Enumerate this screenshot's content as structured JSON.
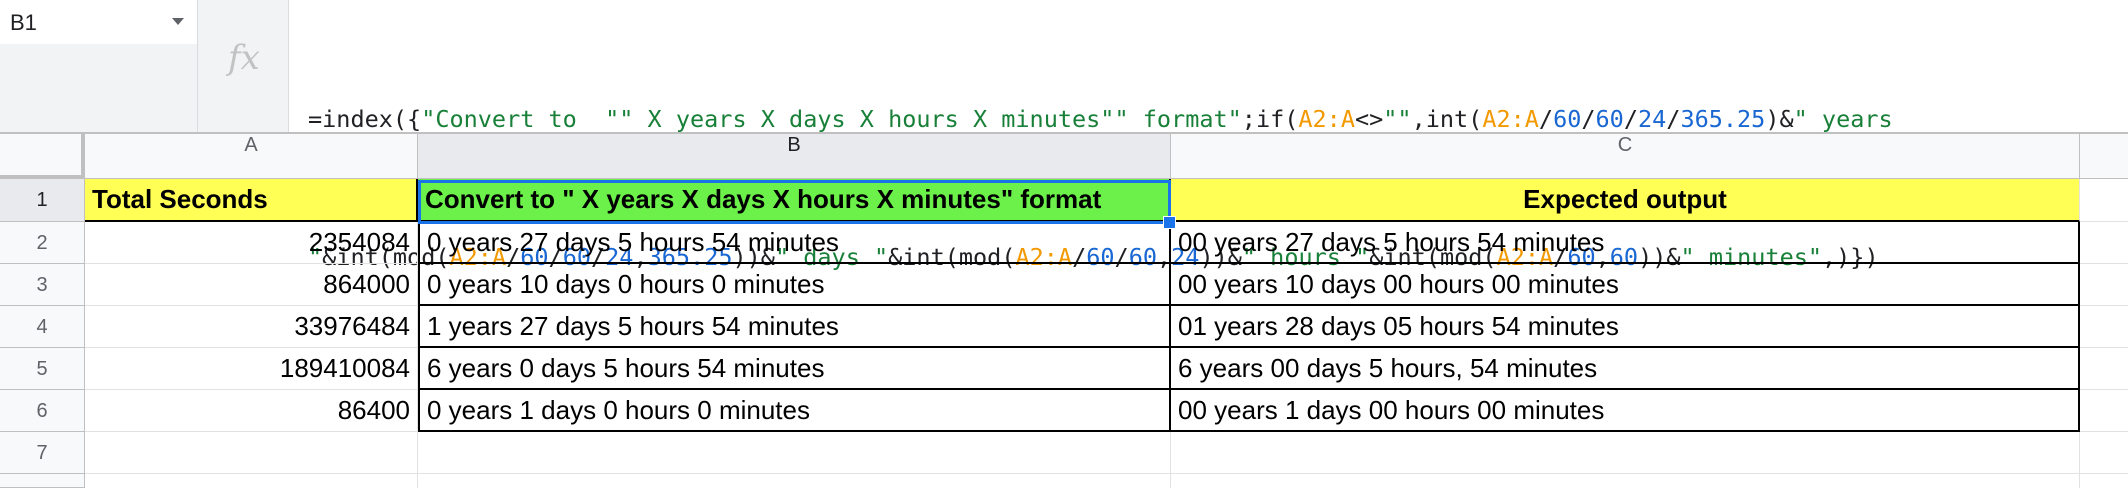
{
  "name_box": {
    "ref": "B1"
  },
  "fx_label": "fx",
  "formula": {
    "line1": [
      {
        "t": "=index({",
        "c": "#202124"
      },
      {
        "t": "\"Convert to  \"\" X years X days X hours X minutes\"\" format\"",
        "c": "#188038"
      },
      {
        "t": ";if(",
        "c": "#202124"
      },
      {
        "t": "A2:A",
        "c": "#f29900"
      },
      {
        "t": "<>",
        "c": "#202124"
      },
      {
        "t": "\"\"",
        "c": "#188038"
      },
      {
        "t": ",int(",
        "c": "#202124"
      },
      {
        "t": "A2:A",
        "c": "#f29900"
      },
      {
        "t": "/",
        "c": "#202124"
      },
      {
        "t": "60",
        "c": "#1967d2"
      },
      {
        "t": "/",
        "c": "#202124"
      },
      {
        "t": "60",
        "c": "#1967d2"
      },
      {
        "t": "/",
        "c": "#202124"
      },
      {
        "t": "24",
        "c": "#1967d2"
      },
      {
        "t": "/",
        "c": "#202124"
      },
      {
        "t": "365.25",
        "c": "#1967d2"
      },
      {
        "t": ")&",
        "c": "#202124"
      },
      {
        "t": "\" years",
        "c": "#188038"
      }
    ],
    "line2": [
      {
        "t": "\"",
        "c": "#188038"
      },
      {
        "t": "&int(mod(",
        "c": "#202124"
      },
      {
        "t": "A2:A",
        "c": "#f29900"
      },
      {
        "t": "/",
        "c": "#202124"
      },
      {
        "t": "60",
        "c": "#1967d2"
      },
      {
        "t": "/",
        "c": "#202124"
      },
      {
        "t": "60",
        "c": "#1967d2"
      },
      {
        "t": "/",
        "c": "#202124"
      },
      {
        "t": "24",
        "c": "#1967d2"
      },
      {
        "t": ",",
        "c": "#202124"
      },
      {
        "t": "365.25",
        "c": "#1967d2"
      },
      {
        "t": "))&",
        "c": "#202124"
      },
      {
        "t": "\" days \"",
        "c": "#188038"
      },
      {
        "t": "&int(mod(",
        "c": "#202124"
      },
      {
        "t": "A2:A",
        "c": "#f29900"
      },
      {
        "t": "/",
        "c": "#202124"
      },
      {
        "t": "60",
        "c": "#1967d2"
      },
      {
        "t": "/",
        "c": "#202124"
      },
      {
        "t": "60",
        "c": "#1967d2"
      },
      {
        "t": ",",
        "c": "#202124"
      },
      {
        "t": "24",
        "c": "#1967d2"
      },
      {
        "t": "))&",
        "c": "#202124"
      },
      {
        "t": "\" hours \"",
        "c": "#188038"
      },
      {
        "t": "&int(mod(",
        "c": "#202124"
      },
      {
        "t": "A2:A",
        "c": "#f29900"
      },
      {
        "t": "/",
        "c": "#202124"
      },
      {
        "t": "60",
        "c": "#1967d2"
      },
      {
        "t": ",",
        "c": "#202124"
      },
      {
        "t": "60",
        "c": "#1967d2"
      },
      {
        "t": "))&",
        "c": "#202124"
      },
      {
        "t": "\" minutes\"",
        "c": "#188038"
      },
      {
        "t": ",)})",
        "c": "#202124"
      }
    ]
  },
  "columns": [
    "A",
    "B",
    "C"
  ],
  "rows": [
    "1",
    "2",
    "3",
    "4",
    "5",
    "6",
    "7"
  ],
  "headers": {
    "a": "Total Seconds",
    "b": "Convert to  \" X years X days X hours X minutes\" format",
    "c": "Expected output"
  },
  "data": [
    {
      "a": "2354084",
      "b": "0 years 27 days 5 hours 54 minutes",
      "c": "00 years 27 days 5 hours 54 minutes"
    },
    {
      "a": "864000",
      "b": "0 years 10 days 0 hours 0 minutes",
      "c": "00 years 10 days 00  hours 00 minutes"
    },
    {
      "a": "33976484",
      "b": "1 years 27 days 5 hours 54 minutes",
      "c": "01 years 28 days 05  hours 54 minutes"
    },
    {
      "a": "189410084",
      "b": "6 years 0 days 5 hours 54 minutes",
      "c": "6 years 00 days  5 hours, 54 minutes"
    },
    {
      "a": "86400",
      "b": "0 years 1 days 0 hours 0 minutes",
      "c": "00 years 1 days 00  hours 00 minutes"
    }
  ],
  "colors": {
    "header_yellow": "#ffff55",
    "selected_green": "#6cf04a",
    "selection_blue": "#1a73e8"
  }
}
